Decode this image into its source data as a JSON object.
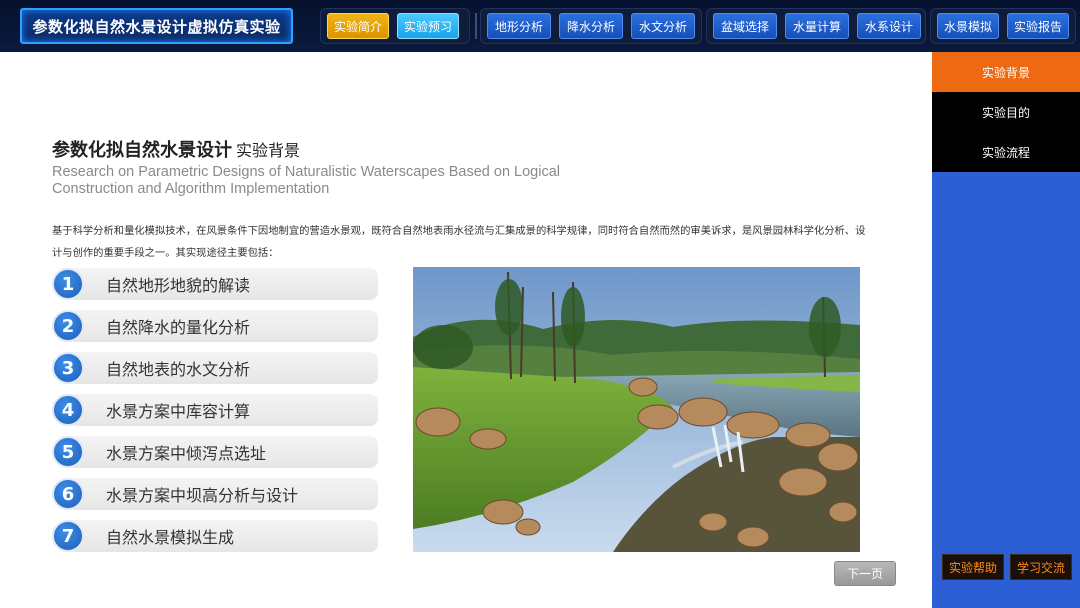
{
  "app_title": "参数化拟自然水景设计虚拟仿真实验",
  "nav": {
    "group1": [
      {
        "label": "实验简介",
        "style": "yellow"
      },
      {
        "label": "实验预习",
        "style": "cyan"
      }
    ],
    "group2": [
      {
        "label": "地形分析"
      },
      {
        "label": "降水分析"
      },
      {
        "label": "水文分析"
      }
    ],
    "group3": [
      {
        "label": "盆域选择"
      },
      {
        "label": "水量计算"
      },
      {
        "label": "水系设计"
      }
    ],
    "group4": [
      {
        "label": "水景模拟"
      },
      {
        "label": "实验报告"
      }
    ]
  },
  "sidebar": {
    "items": [
      {
        "label": "实验背景",
        "state": "active"
      },
      {
        "label": "实验目的",
        "state": "dark"
      },
      {
        "label": "实验流程",
        "state": "dark"
      }
    ],
    "help_label": "实验帮助",
    "exchange_label": "学习交流"
  },
  "content": {
    "title_main": "参数化拟自然水景设计",
    "title_sub": "实验背景",
    "english_title": "Research on Parametric Designs of Naturalistic Waterscapes Based on Logical Construction and Algorithm Implementation",
    "intro": "基于科学分析和量化模拟技术，在风景条件下因地制宜的营造水景观，既符合自然地表雨水径流与汇集成景的科学规律，同时符合自然而然的审美诉求，是风景园林科学化分析、设计与创作的重要手段之一。其实现途径主要包括：",
    "steps": [
      {
        "num": "1",
        "label": "自然地形地貌的解读"
      },
      {
        "num": "2",
        "label": "自然降水的量化分析"
      },
      {
        "num": "3",
        "label": "自然地表的水文分析"
      },
      {
        "num": "4",
        "label": "水景方案中库容计算"
      },
      {
        "num": "5",
        "label": "水景方案中倾泻点选址"
      },
      {
        "num": "6",
        "label": "水景方案中坝高分析与设计"
      },
      {
        "num": "7",
        "label": "自然水景模拟生成"
      }
    ],
    "next_label": "下一页"
  },
  "colors": {
    "sidebar_bg": "#2c5fd3",
    "active_orange": "#ee6a12",
    "badge_blue": "#2a72d0",
    "nav_blue": "#2a6fe0"
  }
}
